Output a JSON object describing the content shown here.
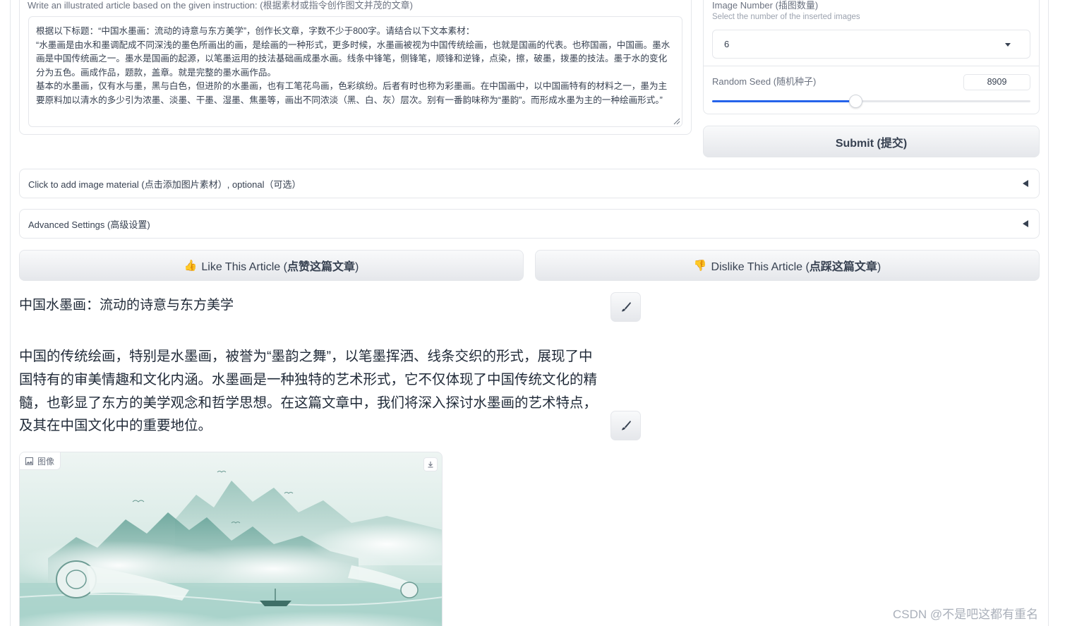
{
  "instruction": {
    "label": "Write an illustrated article based on the given instruction: (根据素材或指令创作图文并茂的文章)",
    "text": "根据以下标题：“中国水墨画：流动的诗意与东方美学”，创作长文章，字数不少于800字。请结合以下文本素材：\n“水墨画是由水和墨调配成不同深浅的墨色所画出的画，是绘画的一种形式，更多时候，水墨画被视为中国传统绘画，也就是国画的代表。也称国画，中国画。墨水画是中国传统画之一。墨水是国画的起源，以笔墨运用的技法基础画成墨水画。线条中锋笔，侧锋笔，顺锋和逆锋，点染，擦，破墨，拨墨的技法。墨于水的变化分为五色。画成作品，题款，盖章。就是完整的墨水画作品。\n基本的水墨画，仅有水与墨，黑与白色，但进阶的水墨画，也有工笔花鸟画，色彩缤纷。后者有时也称为彩墨画。在中国画中，以中国画特有的材料之一，墨为主要原料加以清水的多少引为浓墨、淡墨、干墨、湿墨、焦墨等，画出不同浓淡（黑、白、灰）层次。别有一番韵味称为“墨韵”。而形成水墨为主的一种绘画形式。”"
  },
  "settings": {
    "image_number_label": "Image Number (插图数量)",
    "image_number_hint": "Select the number of the inserted images",
    "image_number_value": "6",
    "seed_label": "Random Seed (随机种子)",
    "seed_value": "8909",
    "seed_fraction": 0.45,
    "submit_label": "Submit (提交)"
  },
  "accordions": {
    "image_material": "Click to add image material (点击添加图片素材）, optional（可选）",
    "advanced": "Advanced Settings (高级设置)"
  },
  "feedback": {
    "like_emoji": "👍",
    "like_label": "Like This Article (",
    "like_cn": "点赞这篇文章",
    "dislike_emoji": "👎",
    "dislike_label": "Dislike This Article (",
    "dislike_cn": "点踩这篇文章",
    "close_paren": ")"
  },
  "article": {
    "title": "中国水墨画：流动的诗意与东方美学",
    "paragraph": "中国的传统绘画，特别是水墨画，被誉为“墨韵之舞”，以笔墨挥洒、线条交织的形式，展现了中国特有的审美情趣和文化内涵。水墨画是一种独特的艺术形式，它不仅体现了中国传统文化的精髓，也彰显了东方的美学观念和哲学思想。在这篇文章中，我们将深入探讨水墨画的艺术特点，及其在中国文化中的重要地位。",
    "image_tag": "图像"
  },
  "watermark": "CSDN @不是吧这都有重名",
  "colors": {
    "accent": "#2563eb",
    "border": "#e5e7eb"
  }
}
